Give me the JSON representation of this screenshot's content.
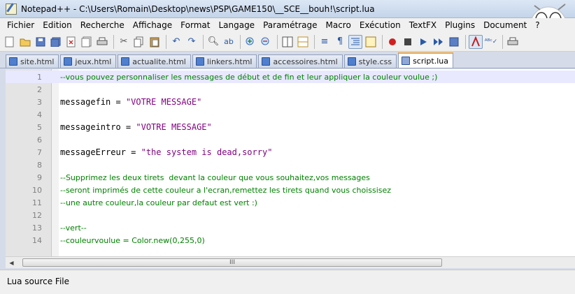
{
  "window": {
    "title": "Notepad++ - C:\\Users\\Romain\\Desktop\\news\\PSP\\GAME150\\__SCE__bouh!\\script.lua"
  },
  "menu": [
    "Fichier",
    "Edition",
    "Recherche",
    "Affichage",
    "Format",
    "Langage",
    "Paramétrage",
    "Macro",
    "Exécution",
    "TextFX",
    "Plugins",
    "Document",
    "?"
  ],
  "tabs": [
    {
      "label": "site.html",
      "active": false
    },
    {
      "label": "jeux.html",
      "active": false
    },
    {
      "label": "actualite.html",
      "active": false
    },
    {
      "label": "linkers.html",
      "active": false
    },
    {
      "label": "accessoires.html",
      "active": false
    },
    {
      "label": "style.css",
      "active": false
    },
    {
      "label": "script.lua",
      "active": true
    }
  ],
  "editor": {
    "lines": [
      {
        "num": "1",
        "text": "--vous pouvez personnaliser les messages de début et de fin et leur appliquer la couleur voulue ;)",
        "kind": "comment",
        "current": true
      },
      {
        "num": "2",
        "text": "",
        "kind": "plain"
      },
      {
        "num": "3",
        "text": "messagefin = ",
        "str": "\"VOTRE MESSAGE\"",
        "kind": "plain"
      },
      {
        "num": "4",
        "text": "",
        "kind": "plain"
      },
      {
        "num": "5",
        "text": "messageintro = ",
        "str": "\"VOTRE MESSAGE\"",
        "kind": "plain"
      },
      {
        "num": "6",
        "text": "",
        "kind": "plain"
      },
      {
        "num": "7",
        "text": "messageErreur = ",
        "str": "\"the system is dead,sorry\"",
        "kind": "plain"
      },
      {
        "num": "8",
        "text": "",
        "kind": "plain"
      },
      {
        "num": "9",
        "text": "--Supprimez les deux tirets  devant la couleur que vous souhaitez,vos messages",
        "kind": "comment"
      },
      {
        "num": "10",
        "text": "--seront imprimés de cette couleur a l'ecran,remettez les tirets quand vous choissisez",
        "kind": "comment"
      },
      {
        "num": "11",
        "text": "--une autre couleur,la couleur par defaut est vert :)",
        "kind": "comment"
      },
      {
        "num": "12",
        "text": "",
        "kind": "plain"
      },
      {
        "num": "13",
        "text": "--vert--",
        "kind": "comment"
      },
      {
        "num": "14",
        "text": "--couleurvoulue = Color.new(0,255,0)",
        "kind": "comment"
      }
    ]
  },
  "scrollbar": {
    "thumb_grip": "III"
  },
  "status": {
    "file_type": "Lua source File"
  },
  "icons": {
    "new": "new-file-icon",
    "open": "open-folder-icon",
    "save": "save-icon",
    "save_all": "save-all-icon",
    "close": "close-file-icon",
    "print": "print-icon"
  }
}
